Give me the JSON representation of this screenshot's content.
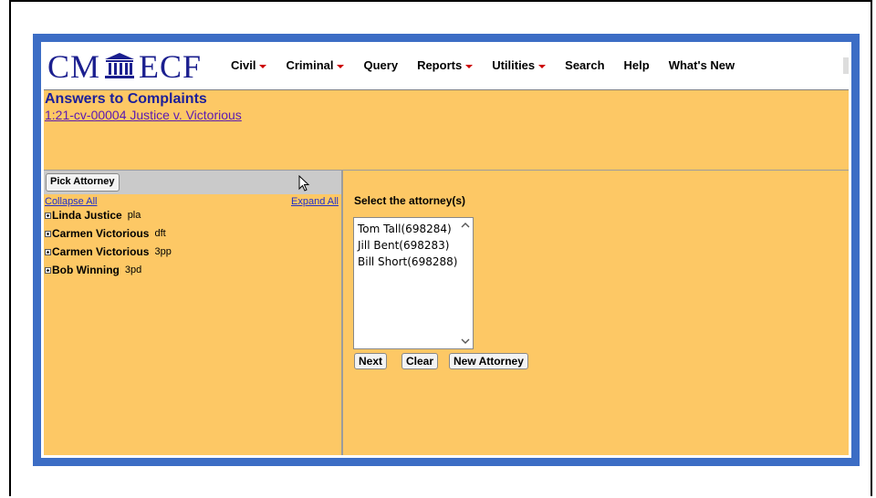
{
  "logo": {
    "left": "CM",
    "right": "ECF"
  },
  "menu": [
    {
      "label": "Civil",
      "dropdown": true
    },
    {
      "label": "Criminal",
      "dropdown": true
    },
    {
      "label": "Query",
      "dropdown": false
    },
    {
      "label": "Reports",
      "dropdown": true
    },
    {
      "label": "Utilities",
      "dropdown": true
    },
    {
      "label": "Search",
      "dropdown": false
    },
    {
      "label": "Help",
      "dropdown": false
    },
    {
      "label": "What's New",
      "dropdown": false
    }
  ],
  "page": {
    "title": "Answers to Complaints",
    "case_link": "1:21-cv-00004 Justice v. Victorious"
  },
  "left_pane": {
    "pick_button": "Pick Attorney",
    "collapse_all": "Collapse All",
    "expand_all": "Expand All",
    "parties": [
      {
        "name": "Linda Justice",
        "role": "pla"
      },
      {
        "name": "Carmen Victorious",
        "role": "dft"
      },
      {
        "name": "Carmen Victorious",
        "role": "3pp"
      },
      {
        "name": "Bob Winning",
        "role": "3pd"
      }
    ]
  },
  "right_pane": {
    "select_label": "Select the attorney(s)",
    "attorneys": [
      "Tom Tall(698284)",
      "Jill Bent(698283)",
      "Bill Short(698288)"
    ],
    "buttons": {
      "next": "Next",
      "clear": "Clear",
      "new_attorney": "New Attorney"
    }
  },
  "colors": {
    "frame": "#3c6dc5",
    "panel": "#fdc865",
    "logo": "#1b1f8f",
    "link": "#1f2fc9"
  },
  "icons": {
    "logo_emblem": "courthouse-icon",
    "cursor": "mouse-pointer-icon",
    "expand_node": "plus-box-icon"
  }
}
